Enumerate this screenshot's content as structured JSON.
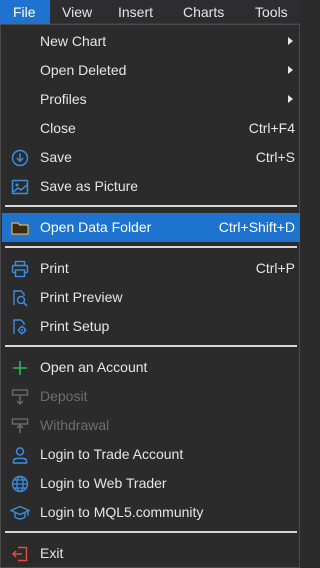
{
  "menubar": {
    "file": "File",
    "view": "View",
    "insert": "Insert",
    "charts": "Charts",
    "tools": "Tools"
  },
  "menu": {
    "new_chart": {
      "label": "New Chart"
    },
    "open_deleted": {
      "label": "Open Deleted"
    },
    "profiles": {
      "label": "Profiles"
    },
    "close": {
      "label": "Close",
      "shortcut": "Ctrl+F4"
    },
    "save": {
      "label": "Save",
      "shortcut": "Ctrl+S"
    },
    "save_as_picture": {
      "label": "Save as Picture"
    },
    "open_data_folder": {
      "label": "Open Data Folder",
      "shortcut": "Ctrl+Shift+D"
    },
    "print": {
      "label": "Print",
      "shortcut": "Ctrl+P"
    },
    "print_preview": {
      "label": "Print Preview"
    },
    "print_setup": {
      "label": "Print Setup"
    },
    "open_account": {
      "label": "Open an Account"
    },
    "deposit": {
      "label": "Deposit"
    },
    "withdrawal": {
      "label": "Withdrawal"
    },
    "login_trade": {
      "label": "Login to Trade Account"
    },
    "login_web": {
      "label": "Login to Web Trader"
    },
    "login_mql5": {
      "label": "Login to MQL5.community"
    },
    "exit": {
      "label": "Exit"
    }
  },
  "colors": {
    "highlight": "#1e73cf",
    "icon_blue": "#3b8de0",
    "icon_green": "#2eb85c",
    "icon_red": "#e0503c",
    "disabled": "#6e6e6e"
  }
}
